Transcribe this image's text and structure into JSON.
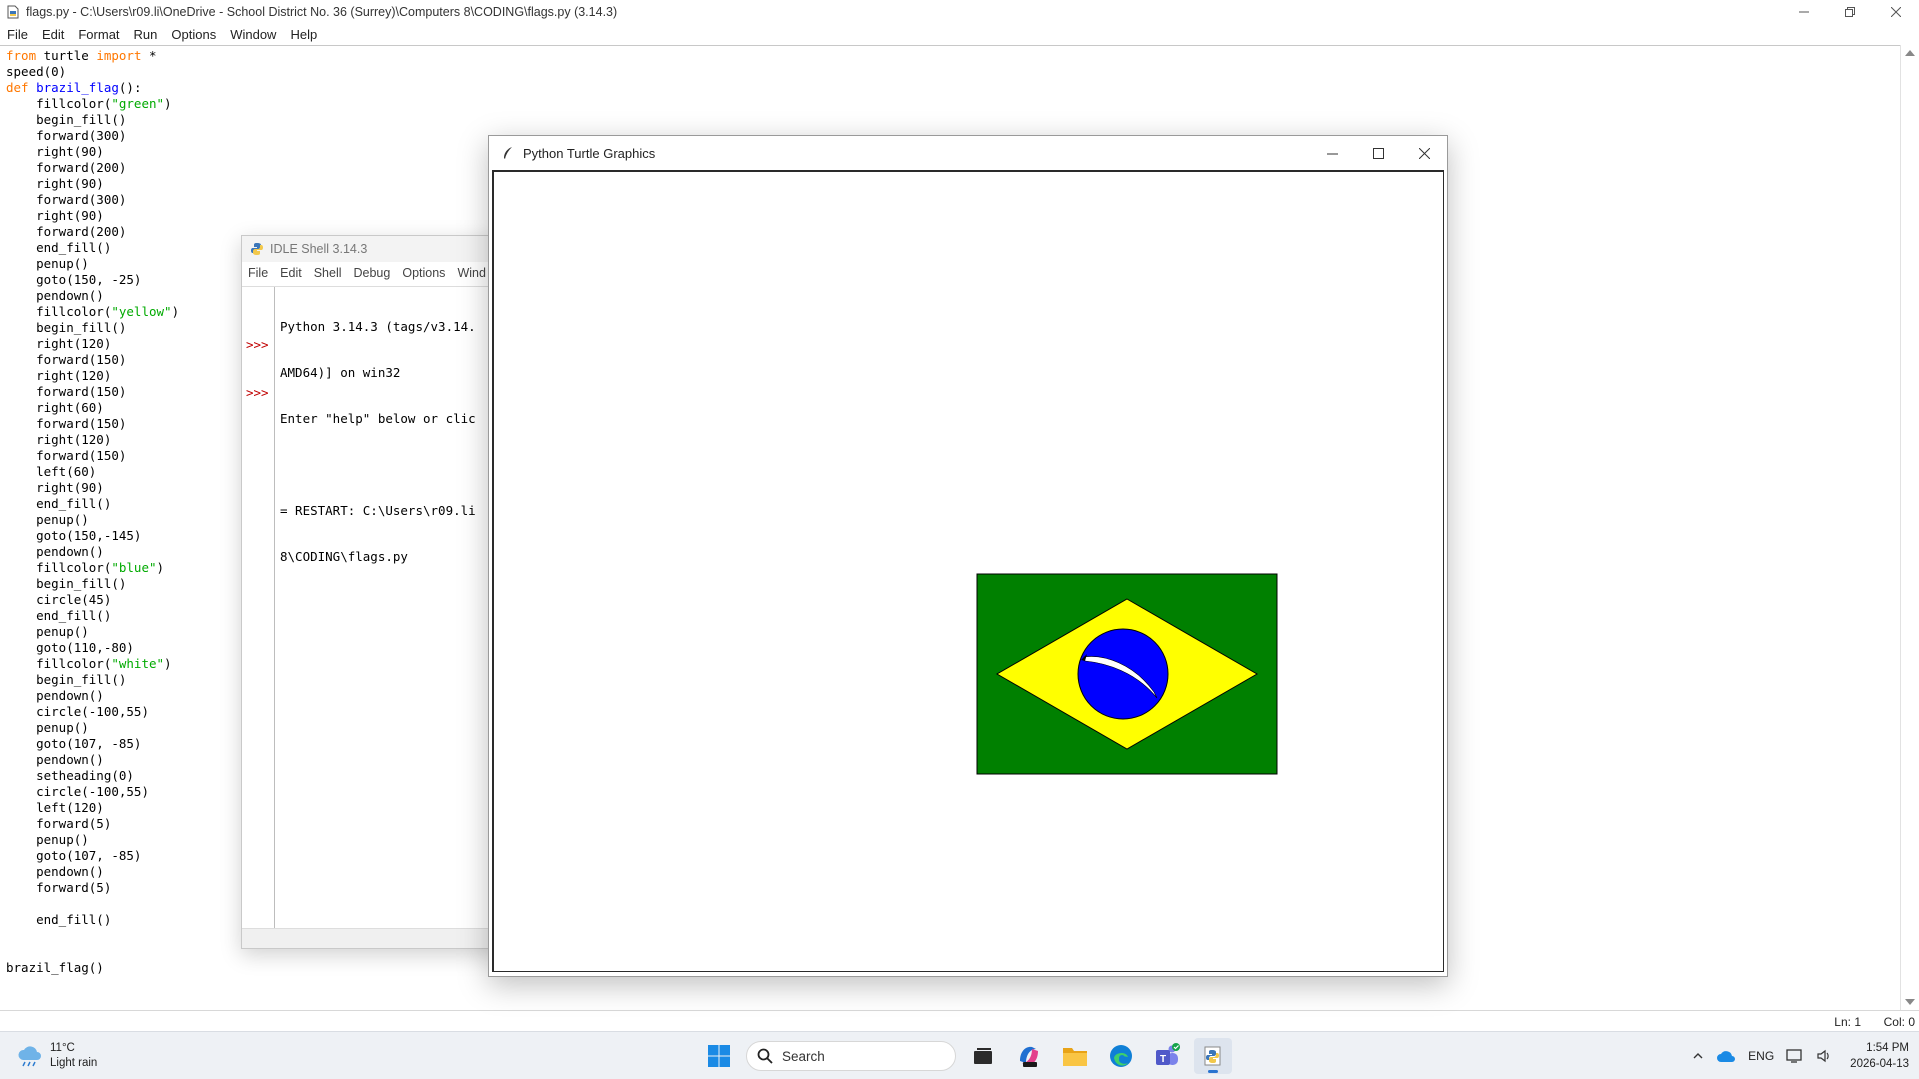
{
  "editor": {
    "title": "flags.py - C:\\Users\\r09.li\\OneDrive - School District No. 36 (Surrey)\\Computers 8\\CODING\\flags.py (3.14.3)",
    "menu": [
      "File",
      "Edit",
      "Format",
      "Run",
      "Options",
      "Window",
      "Help"
    ],
    "code_lines": [
      [
        {
          "t": "from",
          "c": "kw"
        },
        {
          "t": " turtle "
        },
        {
          "t": "import",
          "c": "kw"
        },
        {
          "t": " *"
        }
      ],
      [
        {
          "t": "speed(0)"
        }
      ],
      [
        {
          "t": "def",
          "c": "kw"
        },
        {
          "t": " "
        },
        {
          "t": "brazil_flag",
          "c": "fn"
        },
        {
          "t": "():"
        }
      ],
      [
        {
          "t": "    fillcolor("
        },
        {
          "t": "\"green\"",
          "c": "str"
        },
        {
          "t": ")"
        }
      ],
      [
        {
          "t": "    begin_fill()"
        }
      ],
      [
        {
          "t": "    forward(300)"
        }
      ],
      [
        {
          "t": "    right(90)"
        }
      ],
      [
        {
          "t": "    forward(200)"
        }
      ],
      [
        {
          "t": "    right(90)"
        }
      ],
      [
        {
          "t": "    forward(300)"
        }
      ],
      [
        {
          "t": "    right(90)"
        }
      ],
      [
        {
          "t": "    forward(200)"
        }
      ],
      [
        {
          "t": "    end_fill()"
        }
      ],
      [
        {
          "t": "    penup()"
        }
      ],
      [
        {
          "t": "    goto(150, -25)"
        }
      ],
      [
        {
          "t": "    pendown()"
        }
      ],
      [
        {
          "t": "    fillcolor("
        },
        {
          "t": "\"yellow\"",
          "c": "str"
        },
        {
          "t": ")"
        }
      ],
      [
        {
          "t": "    begin_fill()"
        }
      ],
      [
        {
          "t": "    right(120)"
        }
      ],
      [
        {
          "t": "    forward(150)"
        }
      ],
      [
        {
          "t": "    right(120)"
        }
      ],
      [
        {
          "t": "    forward(150)"
        }
      ],
      [
        {
          "t": "    right(60)"
        }
      ],
      [
        {
          "t": "    forward(150)"
        }
      ],
      [
        {
          "t": "    right(120)"
        }
      ],
      [
        {
          "t": "    forward(150)"
        }
      ],
      [
        {
          "t": "    left(60)"
        }
      ],
      [
        {
          "t": "    right(90)"
        }
      ],
      [
        {
          "t": "    end_fill()"
        }
      ],
      [
        {
          "t": "    penup()"
        }
      ],
      [
        {
          "t": "    goto(150,-145)"
        }
      ],
      [
        {
          "t": "    pendown()"
        }
      ],
      [
        {
          "t": "    fillcolor("
        },
        {
          "t": "\"blue\"",
          "c": "str"
        },
        {
          "t": ")"
        }
      ],
      [
        {
          "t": "    begin_fill()"
        }
      ],
      [
        {
          "t": "    circle(45)"
        }
      ],
      [
        {
          "t": "    end_fill()"
        }
      ],
      [
        {
          "t": "    penup()"
        }
      ],
      [
        {
          "t": "    goto(110,-80)"
        }
      ],
      [
        {
          "t": "    fillcolor("
        },
        {
          "t": "\"white\"",
          "c": "str"
        },
        {
          "t": ")"
        }
      ],
      [
        {
          "t": "    begin_fill()"
        }
      ],
      [
        {
          "t": "    pendown()"
        }
      ],
      [
        {
          "t": "    circle(-100,55)"
        }
      ],
      [
        {
          "t": "    penup()"
        }
      ],
      [
        {
          "t": "    goto(107, -85)"
        }
      ],
      [
        {
          "t": "    pendown()"
        }
      ],
      [
        {
          "t": "    setheading(0)"
        }
      ],
      [
        {
          "t": "    circle(-100,55)"
        }
      ],
      [
        {
          "t": "    left(120)"
        }
      ],
      [
        {
          "t": "    forward(5)"
        }
      ],
      [
        {
          "t": "    penup()"
        }
      ],
      [
        {
          "t": "    goto(107, -85)"
        }
      ],
      [
        {
          "t": "    pendown()"
        }
      ],
      [
        {
          "t": "    forward(5)"
        }
      ],
      [
        {
          "t": ""
        }
      ],
      [
        {
          "t": "    end_fill()"
        }
      ],
      [
        {
          "t": ""
        }
      ],
      [
        {
          "t": ""
        }
      ],
      [
        {
          "t": "brazil_flag()"
        }
      ]
    ],
    "status": {
      "ln": "Ln: 1",
      "col": "Col: 0"
    }
  },
  "shell": {
    "title": "IDLE Shell 3.14.3",
    "menu": [
      "File",
      "Edit",
      "Shell",
      "Debug",
      "Options",
      "Wind"
    ],
    "prompt": ">>>",
    "output_lines": [
      "Python 3.14.3 (tags/v3.14.",
      "AMD64)] on win32",
      "Enter \"help\" below or clic",
      "",
      "= RESTART: C:\\Users\\r09.li",
      "8\\CODING\\flags.py"
    ]
  },
  "turtle": {
    "title": "Python Turtle Graphics",
    "flag_colors": {
      "field": "#008000",
      "rhombus": "#ffff00",
      "globe": "#0000ff",
      "band": "#ffffff"
    }
  },
  "taskbar": {
    "weather": {
      "temp": "11°C",
      "desc": "Light rain"
    },
    "search_label": "Search",
    "tray": {
      "lang": "ENG",
      "time": "1:54 PM",
      "date": "2026-04-13"
    }
  }
}
